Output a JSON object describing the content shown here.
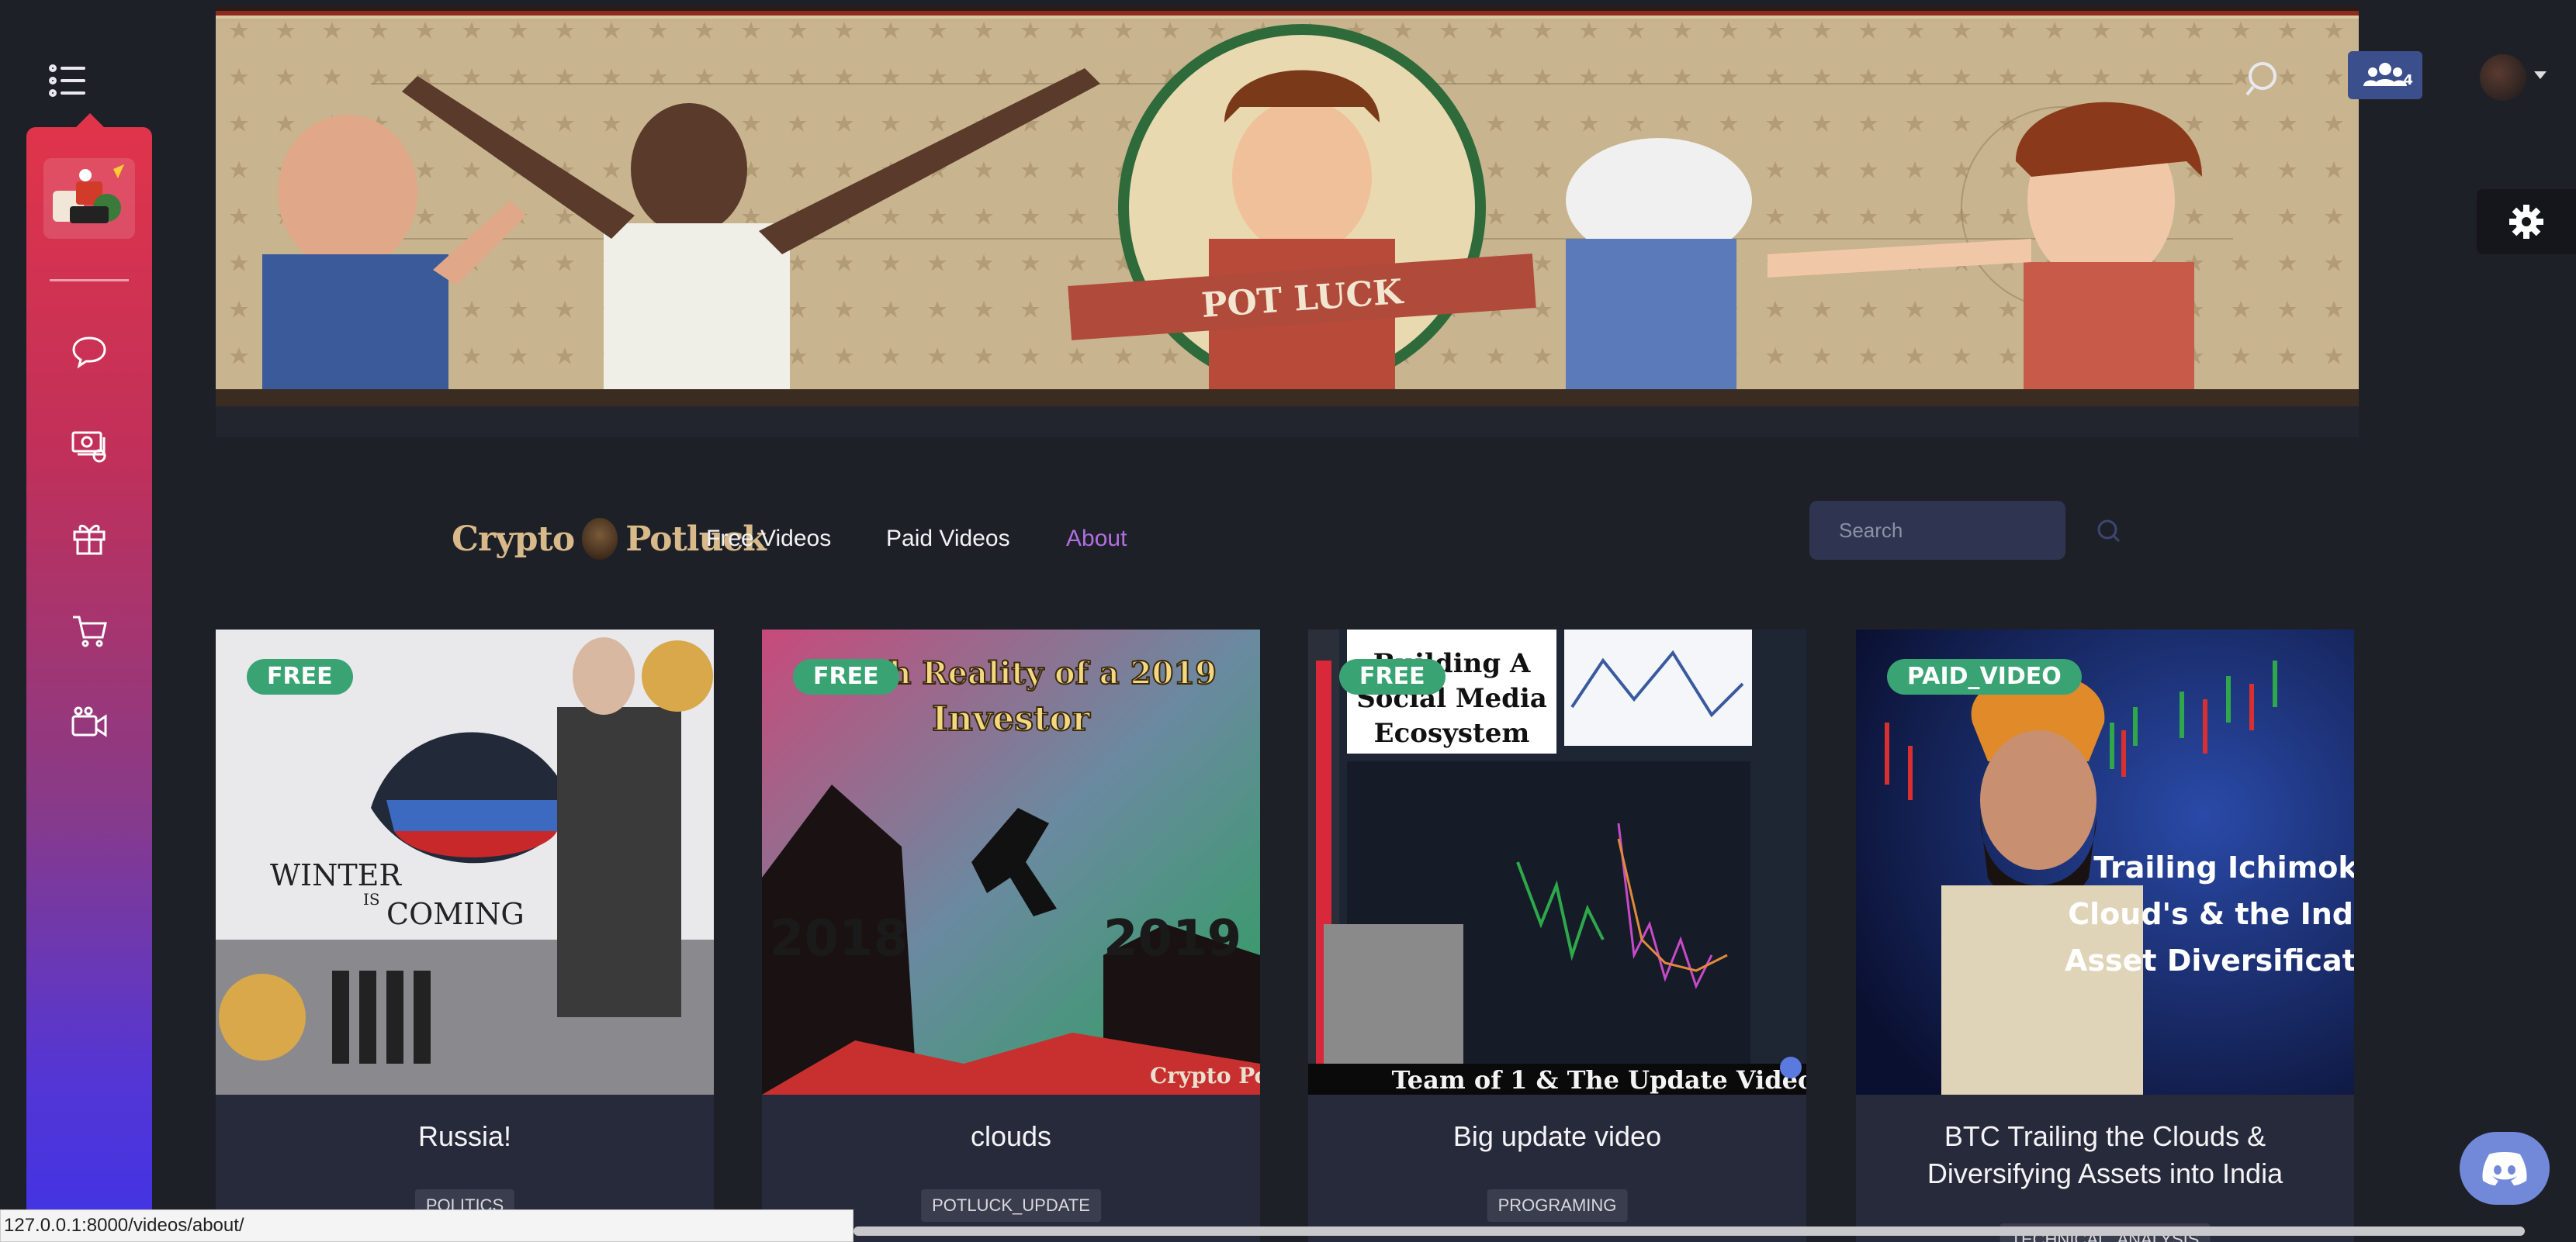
{
  "header": {
    "friends_count": "4"
  },
  "navbar": {
    "brand": "Crypto",
    "brand_second": "Potluck",
    "links": [
      {
        "label": "Free Videos",
        "active": false
      },
      {
        "label": "Paid Videos",
        "active": false
      },
      {
        "label": "About",
        "active": true
      }
    ],
    "search_placeholder": "Search"
  },
  "banner": {
    "sign_text": "POT LUCK"
  },
  "sidebar": {
    "items": [
      {
        "icon": "chat-icon"
      },
      {
        "icon": "money-stack-icon"
      },
      {
        "icon": "gift-icon"
      },
      {
        "icon": "cart-icon"
      },
      {
        "icon": "video-camera-icon"
      }
    ]
  },
  "cards": [
    {
      "badge": "FREE",
      "title": "Russia!",
      "tag": "POLITICS",
      "thumb_texts": [
        "WINTER",
        "IS",
        "COMING"
      ]
    },
    {
      "badge": "FREE",
      "title": "clouds",
      "tag": "POTLUCK_UPDATE",
      "thumb_texts": [
        "Harsh Reality of a 2019",
        "Investor",
        "2018",
        "2019",
        "Crypto Potluck"
      ]
    },
    {
      "badge": "FREE",
      "title": "Big update video",
      "tag": "PROGRAMING",
      "thumb_texts": [
        "Building A",
        "Social Media",
        "Ecosystem",
        "Team of 1 & The Update Video"
      ]
    },
    {
      "badge": "PAID_VIDEO",
      "title": "BTC Trailing the Clouds & Diversifying Assets into India",
      "tag": "TECHNICAL_ANALYSIS",
      "thumb_texts": [
        "Trailing Ichimoku",
        "Cloud's & the Indian",
        "Asset Diversification"
      ]
    }
  ],
  "status_bar": {
    "url": "127.0.0.1:8000/videos/about/"
  },
  "colors": {
    "page_bg": "#1e2028",
    "card_bg": "#272a3b",
    "badge_green": "#3aa374",
    "nav_active": "#b06fe0",
    "sidebar_top": "#e0344a",
    "sidebar_bottom": "#4033e6"
  }
}
